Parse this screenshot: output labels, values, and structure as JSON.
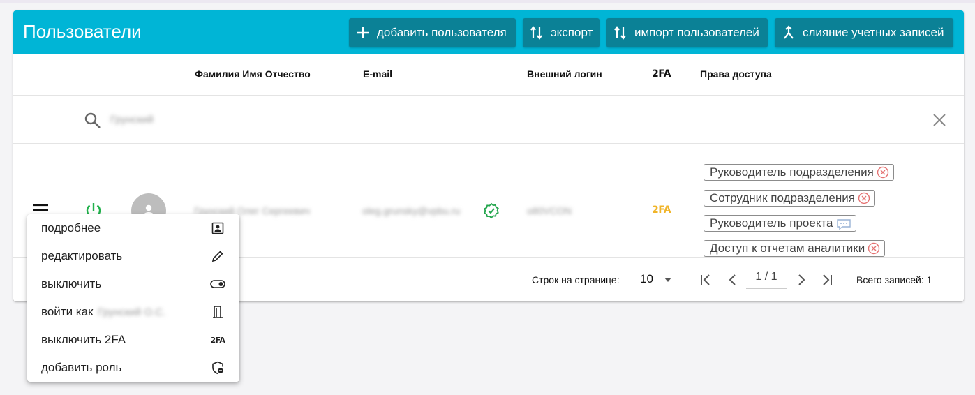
{
  "header": {
    "title": "Пользователи",
    "buttons": {
      "add": "добавить пользователя",
      "export": "экспорт",
      "import": "импорт пользователей",
      "merge": "слияние учетных записей"
    }
  },
  "columns": {
    "fio": "Фамилия Имя Отчество",
    "email": "E-mail",
    "external_login": "Внешний логин",
    "twofa": "2FA",
    "rights": "Права доступа"
  },
  "search": {
    "value": "Грунский"
  },
  "row": {
    "fio": "Грунский Олег Сергеевич",
    "email": "oleg.grunsky@vpbu.ru",
    "external_login": "o80VCON",
    "twofa": "2FA",
    "roles": [
      {
        "label": "Руководитель подразделения",
        "icon": "remove-circle-icon"
      },
      {
        "label": "Сотрудник подразделения",
        "icon": "remove-circle-icon"
      },
      {
        "label": "Руководитель проекта",
        "icon": "comment-dots-icon"
      },
      {
        "label": "Доступ к отчетам аналитики",
        "icon": "remove-circle-icon"
      }
    ]
  },
  "pagination": {
    "rows_label": "Строк на странице:",
    "rows_value": "10",
    "page": "1 / 1",
    "total_label": "Всего записей: 1"
  },
  "menu": {
    "details": "подробнее",
    "edit": "редактировать",
    "disable": "выключить",
    "login_as": "войти как",
    "login_as_name": "Грунский О.С.",
    "disable_2fa": "выключить 2FA",
    "add_role": "добавить роль"
  },
  "colors": {
    "header": "#00b5d6",
    "header_button": "#0b8196",
    "power_on": "#22b14c",
    "verified": "#22a54c",
    "twofa_active": "#f0b429",
    "chip_remove": "#e57373"
  }
}
